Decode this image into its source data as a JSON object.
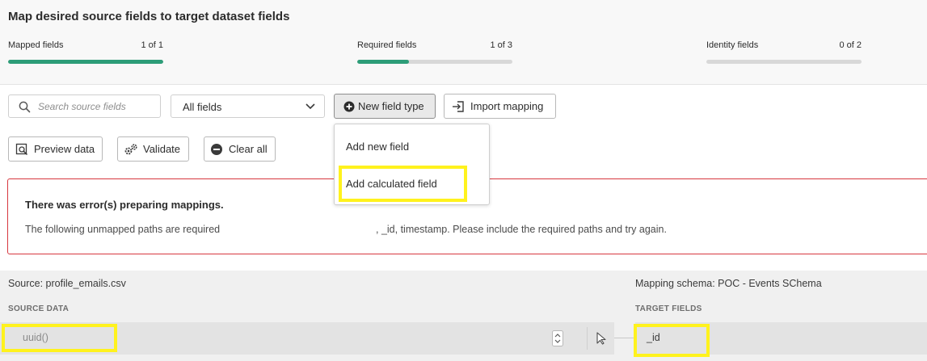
{
  "header": {
    "title": "Map desired source fields to target dataset fields"
  },
  "metrics": [
    {
      "label": "Mapped fields",
      "count": "1 of 1",
      "progress": 1.0
    },
    {
      "label": "Required fields",
      "count": "1 of 3",
      "progress": 0.333
    },
    {
      "label": "Identity fields",
      "count": "0 of 2",
      "progress": 0.0
    }
  ],
  "toolbar": {
    "search_placeholder": "Search source fields",
    "filter_value": "All fields",
    "new_field_type": "New field type",
    "import_mapping": "Import mapping",
    "preview_data": "Preview data",
    "validate": "Validate",
    "clear_all": "Clear all"
  },
  "dropdown": {
    "items": [
      {
        "label": "Add new field"
      },
      {
        "label": "Add calculated field"
      }
    ]
  },
  "error": {
    "title": "There was error(s) preparing mappings.",
    "text_part1": "The following unmapped paths are required",
    "text_part2": ", _id, timestamp. Please include the required paths and try again."
  },
  "mapping": {
    "source_label": "Source: profile_emails.csv",
    "schema_label": "Mapping schema: POC - Events SChema",
    "source_col": "SOURCE DATA",
    "target_col": "TARGET FIELDS",
    "rows": [
      {
        "source": "uuid()",
        "target": "_id"
      }
    ]
  },
  "colors": {
    "accent": "#2d9d78",
    "error": "#d7373f",
    "highlight": "#fff21d"
  }
}
